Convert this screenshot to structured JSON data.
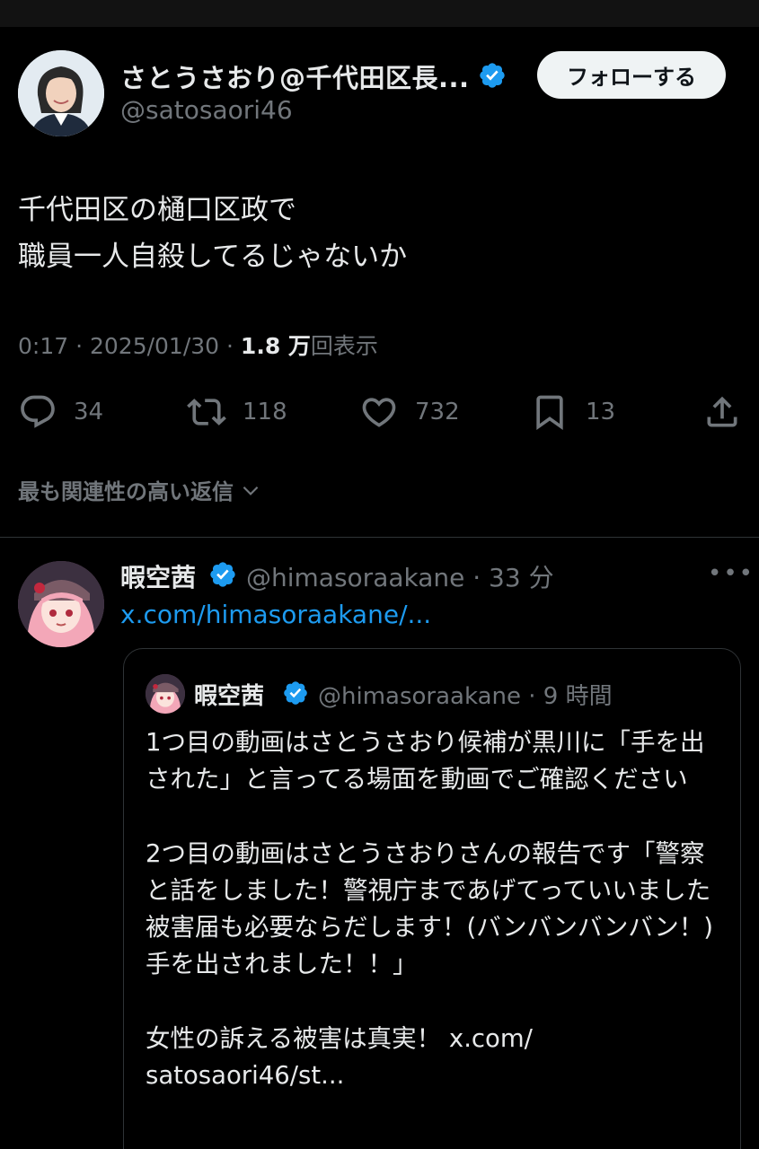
{
  "author": {
    "name": "さとうさおり@千代田区長...",
    "handle": "@satosaori46",
    "follow_label": "フォローする"
  },
  "tweet": {
    "text": "千代田区の樋口区政で\n職員一人自殺してるじゃないか",
    "time": "0:17 · 2025/01/30 · ",
    "views_count": "1.8 万",
    "views_label": "回表示"
  },
  "actions": {
    "replies": "34",
    "reposts": "118",
    "likes": "732",
    "bookmarks": "13"
  },
  "replies_sort_label": "最も関連性の高い返信",
  "reply": {
    "name": "暇空茜",
    "handle_time": "@himasoraakane · 33 分",
    "link": "x.com/himasoraakane/...",
    "quote": {
      "name": "暇空茜",
      "handle_time": "@himasoraakane · 9 時間",
      "text": "1つ目の動画はさとうさおり候補が黒川に「手を出された」と言ってる場面を動画でご確認ください\n\n2つ目の動画はさとうさおりさんの報告です「警察と話をしました！警視庁まであげてっていいました被害届も必要ならだします！(バンバンバンバン！)手を出されました！！」\n\n女性の訴える被害は真実！ x.com/\nsatosaori46/st..."
    }
  },
  "colors": {
    "background": "#000000",
    "text": "#e7e9ea",
    "secondary": "#71767b",
    "accent": "#1d9bf0",
    "border": "#2f3336"
  },
  "icons": [
    "reply-icon",
    "repost-icon",
    "like-icon",
    "bookmark-icon",
    "share-icon",
    "verified-badge-icon",
    "chevron-down-icon",
    "more-icon"
  ]
}
